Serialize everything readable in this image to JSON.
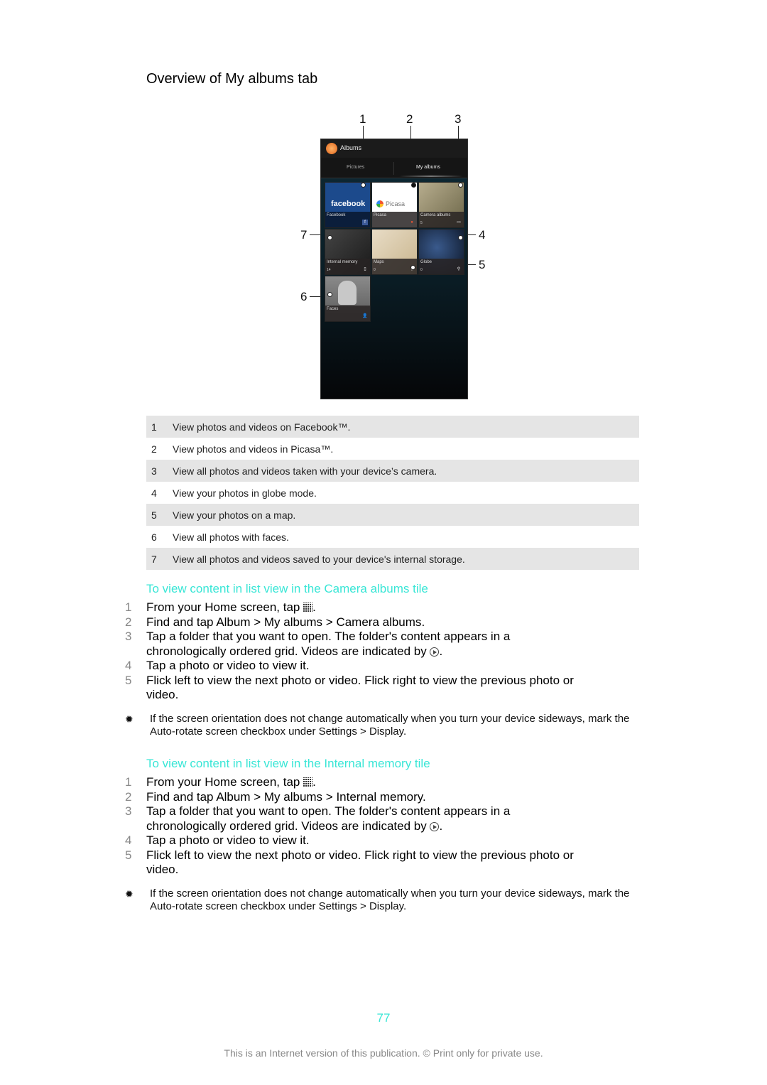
{
  "title": "Overview of My albums tab",
  "figure": {
    "callouts": [
      "1",
      "2",
      "3",
      "4",
      "5",
      "6",
      "7"
    ],
    "app_title": "Albums",
    "tabs": [
      "Pictures",
      "My albums"
    ],
    "tiles": [
      {
        "label": "Facebook",
        "count": "",
        "badge": "f",
        "art": "facebook"
      },
      {
        "label": "Picasa",
        "count": "",
        "badge": "●",
        "art": "Picasa"
      },
      {
        "label": "Camera albums",
        "count": "5",
        "badge": "▭"
      },
      {
        "label": "Internal memory",
        "count": "14",
        "badge": "▯"
      },
      {
        "label": "Maps",
        "count": "0",
        "badge": "⚲"
      },
      {
        "label": "Globe",
        "count": "0",
        "badge": "⚲"
      },
      {
        "label": "Faces",
        "count": "",
        "badge": "👤"
      }
    ]
  },
  "legend": [
    {
      "num": "1",
      "text": "View photos and videos on Facebook™."
    },
    {
      "num": "2",
      "text": "View photos and videos in Picasa™."
    },
    {
      "num": "3",
      "text": "View all photos and videos taken with your device’s camera."
    },
    {
      "num": "4",
      "text": "View your photos in globe mode."
    },
    {
      "num": "5",
      "text": "View your photos on a map."
    },
    {
      "num": "6",
      "text": "View all photos with faces."
    },
    {
      "num": "7",
      "text": "View all photos and videos saved to your device's internal storage."
    }
  ],
  "sections": [
    {
      "heading": "To view content in list view in the Camera albums tile",
      "steps": [
        {
          "num": "1",
          "parts": [
            "From your ",
            "Home screen",
            ", tap ",
            "",
            ""
          ]
        },
        {
          "num": "2",
          "parts": [
            "Find and tap ",
            "Album",
            " > ",
            "My albums",
            " > ",
            "Camera albums",
            "."
          ]
        },
        {
          "num": "3",
          "text_a": "Tap a folder that you want to open. The folder's content appears in a chronologically ordered grid. Videos are indicated by ",
          "text_b": "."
        },
        {
          "num": "4",
          "text": "Tap a photo or video to view it."
        },
        {
          "num": "5",
          "text": "Flick left to view the next photo or video. Flick right to view the previous photo or video."
        }
      ],
      "tip": {
        "a": "If the screen orientation does not change automatically when you turn your device sideways, mark the ",
        "b": "Auto-rotate screen",
        "c": " checkbox under ",
        "d": "Settings",
        "e": " > ",
        "f": "Display",
        "g": "."
      }
    },
    {
      "heading": "To view content in list view in the Internal memory tile",
      "steps": [
        {
          "num": "1",
          "parts": [
            "From your ",
            "Home screen",
            ", tap ",
            "",
            ""
          ]
        },
        {
          "num": "2",
          "parts": [
            "Find and tap ",
            "Album",
            " > ",
            "My albums",
            " > ",
            "Internal memory",
            "."
          ]
        },
        {
          "num": "3",
          "text_a": "Tap a folder that you want to open. The folder's content appears in a chronologically ordered grid. Videos are indicated by ",
          "text_b": "."
        },
        {
          "num": "4",
          "text": "Tap a photo or video to view it."
        },
        {
          "num": "5",
          "text": "Flick left to view the next photo or video. Flick right to view the previous photo or video."
        }
      ],
      "tip": {
        "a": "If the screen orientation does not change automatically when you turn your device sideways, mark the ",
        "b": "Auto-rotate screen",
        "c": " checkbox under ",
        "d": "Settings",
        "e": " > ",
        "f": "Display",
        "g": "."
      }
    }
  ],
  "page_number": "77",
  "footer": "This is an Internet version of this publication. © Print only for private use."
}
